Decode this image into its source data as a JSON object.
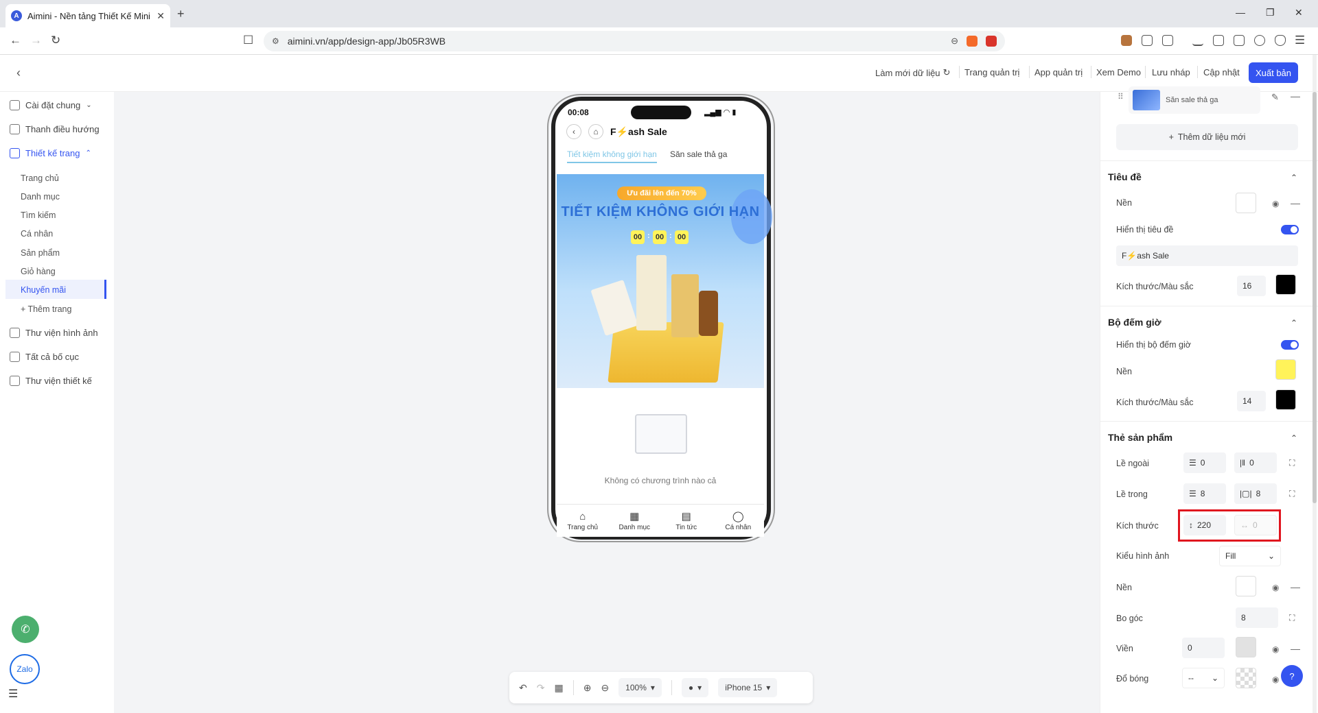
{
  "browser": {
    "tab_title": "Aimini - Nền tảng Thiết Kế Mini",
    "url": "aimini.vn/app/design-app/Jb05R3WB"
  },
  "header": {
    "refresh_label": "Làm mới dữ liệu",
    "admin_label": "Trang quản trị",
    "admin_app_label": "App quản trị",
    "demo_label": "Xem Demo",
    "draft_label": "Lưu nháp",
    "update_label": "Cập nhật",
    "publish_label": "Xuất bản"
  },
  "sidebar": {
    "general": "Cài đặt chung",
    "navbar": "Thanh điều hướng",
    "page_design": "Thiết kế trang",
    "pages": [
      "Trang chủ",
      "Danh mục",
      "Tìm kiếm",
      "Cá nhân",
      "Sản phẩm",
      "Giỏ hàng",
      "Khuyến mãi"
    ],
    "add_page": "+ Thêm trang",
    "image_library": "Thư viện hình ảnh",
    "all_layouts": "Tất cả bố cục",
    "design_library": "Thư viện thiết kế",
    "zalo": "Zalo"
  },
  "phone": {
    "time": "00:08",
    "title": "F⚡ash Sale",
    "tab_active": "Tiết kiệm không giới hạn",
    "tab_other": "Săn sale thả ga",
    "banner_pill": "Ưu đãi lên đến 70%",
    "banner_heading": "TIẾT KIỆM KHÔNG GIỚI HẠN",
    "countdown": [
      "00",
      "00",
      "00"
    ],
    "empty_text": "Không có chương trình nào cả",
    "tabbar": [
      "Trang chủ",
      "Danh mục",
      "Tin tức",
      "Cá nhân"
    ]
  },
  "toolbar": {
    "zoom": "100%",
    "device": "iPhone 15"
  },
  "panel": {
    "data_item": "Săn sale thả ga",
    "add_data": "Thêm dữ liệu mới",
    "title_section": "Tiêu đề",
    "bg_label": "Nền",
    "show_title": "Hiển thị tiêu đề",
    "title_value": "F⚡ash Sale",
    "size_color": "Kích thước/Màu sắc",
    "title_size": "16",
    "countdown_section": "Bộ đếm giờ",
    "show_countdown": "Hiển thị bộ đếm giờ",
    "countdown_size": "14",
    "card_section": "Thẻ sản phẩm",
    "margin_label": "Lề ngoài",
    "margin_v": "0",
    "margin_h": "0",
    "padding_label": "Lề trong",
    "padding_v": "8",
    "padding_h": "8",
    "size_label": "Kích thước",
    "size_height": "220",
    "size_width": "0",
    "image_style_label": "Kiểu hình ảnh",
    "image_style": "Fill",
    "radius_label": "Bo góc",
    "radius": "8",
    "border_label": "Viền",
    "border": "0",
    "shadow_label": "Đổ bóng",
    "shadow": "--"
  },
  "colors": {
    "accent": "#3454f0",
    "countdown_bg": "#fff35a",
    "title_color": "#000000",
    "highlight": "#e0141e"
  }
}
